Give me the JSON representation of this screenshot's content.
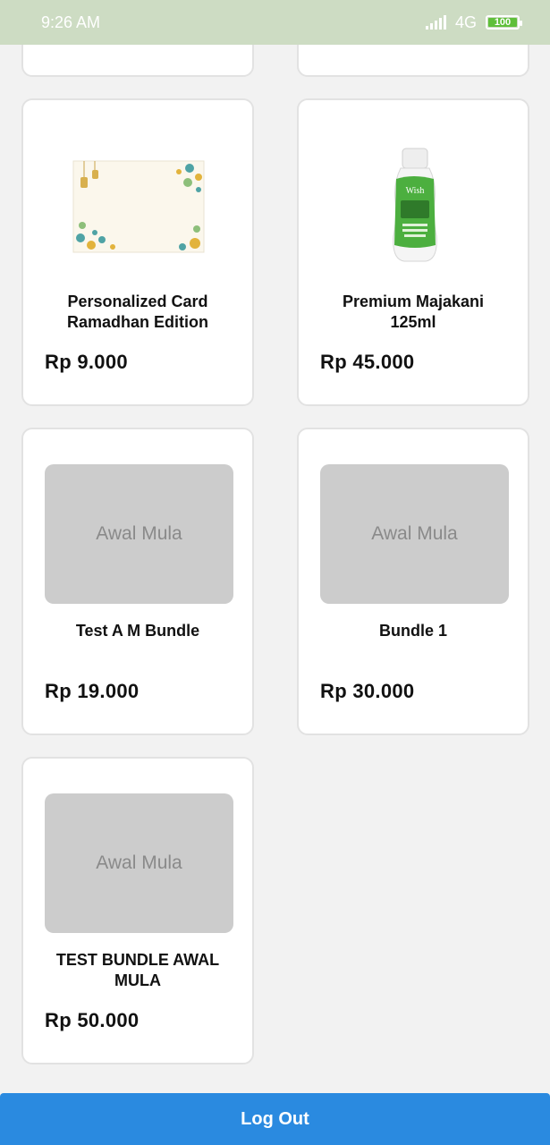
{
  "status_bar": {
    "time": "9:26 AM",
    "network": "4G",
    "battery": "100"
  },
  "products": [
    {
      "name": "Personalized Card Ramadhan Edition",
      "price": "Rp  9.000",
      "image": "ramadhan-card-image"
    },
    {
      "name": "Premium Majakani 125ml",
      "price": "Rp  45.000",
      "image": "majakani-bottle-image"
    },
    {
      "name": "Test A M Bundle",
      "price": "Rp  19.000",
      "image_placeholder": "Awal Mula"
    },
    {
      "name": "Bundle 1",
      "price": "Rp  30.000",
      "image_placeholder": "Awal Mula"
    },
    {
      "name": "TEST BUNDLE AWAL MULA",
      "price": "Rp  50.000",
      "image_placeholder": "Awal Mula"
    }
  ],
  "footer": {
    "logout_label": "Log Out"
  },
  "colors": {
    "status_bar": "#cddcc3",
    "page_background": "#f2f2f2",
    "logout_button": "#2a8ae0"
  }
}
